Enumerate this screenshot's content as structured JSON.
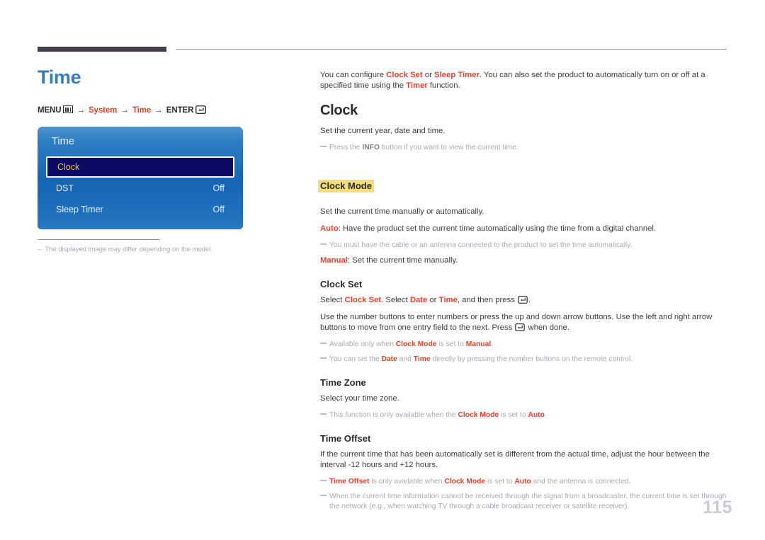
{
  "document": {
    "page_number": "115",
    "accent_color": "#e8402a",
    "title_color": "#3a7cbe",
    "highlight_color": "#f5dd7a"
  },
  "left": {
    "page_title": "Time",
    "breadcrumb": {
      "menu_label": "MENU",
      "menu_icon": "menu-bars-icon",
      "arrow": "→",
      "item1": "System",
      "item2": "Time",
      "enter_label": "ENTER",
      "enter_icon": "enter-key-icon"
    },
    "osd": {
      "title": "Time",
      "rows": [
        {
          "label": "Clock",
          "value": "",
          "selected": true
        },
        {
          "label": "DST",
          "value": "Off",
          "selected": false
        },
        {
          "label": "Sleep Timer",
          "value": "Off",
          "selected": false
        }
      ]
    },
    "caption": "The displayed image may differ depending on the model."
  },
  "right": {
    "intro": {
      "part1": "You can configure ",
      "b1": "Clock Set",
      "part2": " or ",
      "b2": "Sleep Timer",
      "part3": ". You can also set the product to automatically turn on or off at a specified time using the ",
      "b3": "Timer",
      "part4": " function."
    },
    "clock": {
      "heading": "Clock",
      "desc": "Set the current year, date and time.",
      "note1": {
        "part1": "Press the ",
        "b1": "INFO",
        "part2": " button if you want to view the current time."
      }
    },
    "clock_mode": {
      "heading": "Clock Mode",
      "highlighted": true,
      "desc": "Set the current time manually or automatically.",
      "auto": {
        "b1": "Auto",
        "part1": ": Have the product set the current time automatically using the time from a digital channel."
      },
      "note1": "You must have the cable or an antenna connected to the product to set the time automatically.",
      "manual": {
        "b1": "Manual",
        "part1": ": Set the current time manually."
      }
    },
    "clock_set": {
      "heading": "Clock Set",
      "line1": {
        "part1": "Select ",
        "b1": "Clock Set",
        "part2": ". Select ",
        "b2": "Date",
        "part3": " or ",
        "b3": "Time",
        "part4": ", and then press ",
        "icon": "enter-key-icon",
        "part5": "."
      },
      "line2": {
        "part1": "Use the number buttons to enter numbers or press the up and down arrow buttons. Use the left and right arrow buttons to move from one entry field to the next. Press ",
        "icon": "enter-key-icon",
        "part2": " when done."
      },
      "note1": {
        "part1": "Available only when ",
        "b1": "Clock Mode",
        "part2": " is set to ",
        "b2": "Manual",
        "part3": "."
      },
      "note2": {
        "part1": "You can set the ",
        "b1": "Date",
        "part2": " and ",
        "b2": "Time",
        "part3": " directly by pressing the number buttons on the remote control."
      }
    },
    "time_zone": {
      "heading": "Time Zone",
      "desc": "Select your time zone.",
      "note1": {
        "part1": "This function is only available when the ",
        "b1": "Clock Mode",
        "part2": " is set to ",
        "b2": "Auto",
        "part3": "."
      }
    },
    "time_offset": {
      "heading": "Time Offset",
      "desc": "If the current time that has been automatically set is different from the actual time, adjust the hour between the interval -12 hours and +12 hours.",
      "note1": {
        "b1": "Time Offset",
        "part1": " is only available when ",
        "b2": "Clock Mode",
        "part2": " is set to ",
        "b3": "Auto",
        "part3": " and the antenna is connected."
      },
      "note2": "When the current time information cannot be received through the signal from a broadcaster, the current time is set through the network (e.g., when watching TV through a cable broadcast receiver or satellite receiver)."
    }
  }
}
